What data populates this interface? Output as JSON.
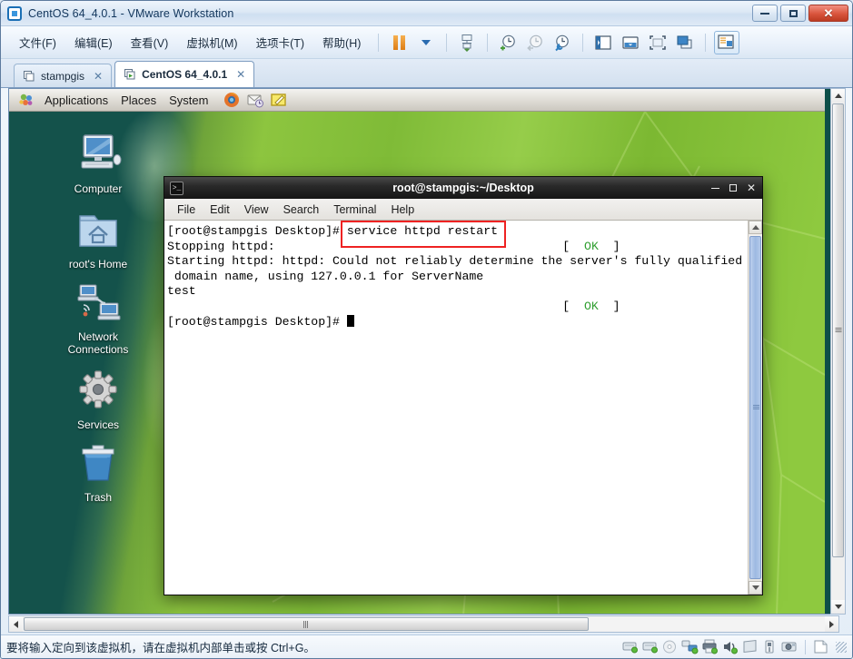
{
  "window": {
    "title": "CentOS 64_4.0.1 - VMware Workstation",
    "app_icon": "vmware-logo-icon",
    "controls": {
      "minimize": "minimize-icon",
      "maximize": "maximize-icon",
      "close": "close-icon",
      "close_glyph": "✕"
    }
  },
  "menubar": {
    "items": [
      {
        "label": "文件(F)",
        "name": "menu-file"
      },
      {
        "label": "编辑(E)",
        "name": "menu-edit"
      },
      {
        "label": "查看(V)",
        "name": "menu-view"
      },
      {
        "label": "虚拟机(M)",
        "name": "menu-vm"
      },
      {
        "label": "选项卡(T)",
        "name": "menu-tabs"
      },
      {
        "label": "帮助(H)",
        "name": "menu-help"
      }
    ],
    "toolbar": [
      {
        "name": "pause-button",
        "icon": "pause-icon"
      },
      {
        "name": "power-dropdown",
        "icon": "chevron-down-icon"
      },
      {
        "name": "manage-snapshot-button",
        "icon": "snapshot-manager-icon"
      },
      {
        "name": "take-snapshot-button",
        "icon": "snapshot-add-icon"
      },
      {
        "name": "revert-snapshot-button",
        "icon": "snapshot-revert-icon"
      },
      {
        "name": "snapshot-manager-button",
        "icon": "snapshot-wrench-icon"
      },
      {
        "name": "show-sidebar-button",
        "icon": "sidebar-panel-icon"
      },
      {
        "name": "show-console-button",
        "icon": "console-view-icon"
      },
      {
        "name": "fullscreen-button",
        "icon": "fullscreen-icon"
      },
      {
        "name": "unity-mode-button",
        "icon": "unity-windows-icon"
      },
      {
        "name": "library-toggle-button",
        "icon": "library-panel-icon"
      }
    ]
  },
  "tabs": [
    {
      "label": "stampgis",
      "active": false,
      "close": "✕",
      "name": "tab-stampgis"
    },
    {
      "label": "CentOS 64_4.0.1",
      "active": true,
      "close": "✕",
      "name": "tab-centos"
    }
  ],
  "guest": {
    "panel": {
      "menus": [
        {
          "label": "Applications",
          "name": "gnome-menu-applications"
        },
        {
          "label": "Places",
          "name": "gnome-menu-places"
        },
        {
          "label": "System",
          "name": "gnome-menu-system"
        }
      ],
      "launchers": [
        {
          "name": "firefox-icon"
        },
        {
          "name": "evolution-mail-icon"
        },
        {
          "name": "text-editor-icon"
        }
      ]
    },
    "desktop_icons": [
      {
        "label": "Computer",
        "name": "desktop-icon-computer",
        "icon": "computer-icon"
      },
      {
        "label": "root's Home",
        "name": "desktop-icon-root-home",
        "icon": "home-folder-icon"
      },
      {
        "label": "Network\nConnections",
        "name": "desktop-icon-network-connections",
        "icon": "network-icon"
      },
      {
        "label": "Services",
        "name": "desktop-icon-services",
        "icon": "gear-icon"
      },
      {
        "label": "Trash",
        "name": "desktop-icon-trash",
        "icon": "trash-icon"
      }
    ]
  },
  "terminal": {
    "title": "root@stampgis:~/Desktop",
    "icon": "terminal-icon",
    "controls": {
      "minimize": "_",
      "maximize": "□",
      "close": "✕"
    },
    "menu": [
      {
        "label": "File",
        "name": "terminal-menu-file"
      },
      {
        "label": "Edit",
        "name": "terminal-menu-edit"
      },
      {
        "label": "View",
        "name": "terminal-menu-view"
      },
      {
        "label": "Search",
        "name": "terminal-menu-search"
      },
      {
        "label": "Terminal",
        "name": "terminal-menu-terminal"
      },
      {
        "label": "Help",
        "name": "terminal-menu-help"
      }
    ],
    "lines": {
      "l1_prompt": "[root@stampgis Desktop]# ",
      "l1_command": "service httpd restart",
      "l2": "Stopping httpd:",
      "l2_status_bracket_open": "[  ",
      "l2_status": "OK",
      "l2_status_bracket_close": "  ]",
      "l3": "Starting httpd: httpd: Could not reliably determine the server's fully qualified",
      "l4": " domain name, using 127.0.0.1 for ServerName",
      "l5": "test",
      "l6_status_bracket_open": "[  ",
      "l6_status": "OK",
      "l6_status_bracket_close": "  ]",
      "l7_prompt": "[root@stampgis Desktop]# "
    },
    "annotation": {
      "name": "red-highlight-box",
      "color": "#ee2222"
    },
    "scrollbar": {
      "name": "terminal-scrollbar"
    }
  },
  "statusbar": {
    "message": "要将输入定向到该虚拟机，请在虚拟机内部单击或按 Ctrl+G。",
    "devices": [
      {
        "name": "hard-disk-1-icon"
      },
      {
        "name": "hard-disk-2-icon"
      },
      {
        "name": "cd-dvd-icon"
      },
      {
        "name": "network-adapter-icon"
      },
      {
        "name": "printer-icon"
      },
      {
        "name": "sound-card-icon"
      },
      {
        "name": "display-icon"
      },
      {
        "name": "usb-icon"
      },
      {
        "name": "camera-icon"
      },
      {
        "name": "document-icon"
      }
    ]
  },
  "colors": {
    "accent": "#1a6fb5",
    "highlight": "#ee2222",
    "ok_green": "#2f9e2f",
    "desktop_teal": "#14524b",
    "leaf_green": "#8dc53f"
  }
}
